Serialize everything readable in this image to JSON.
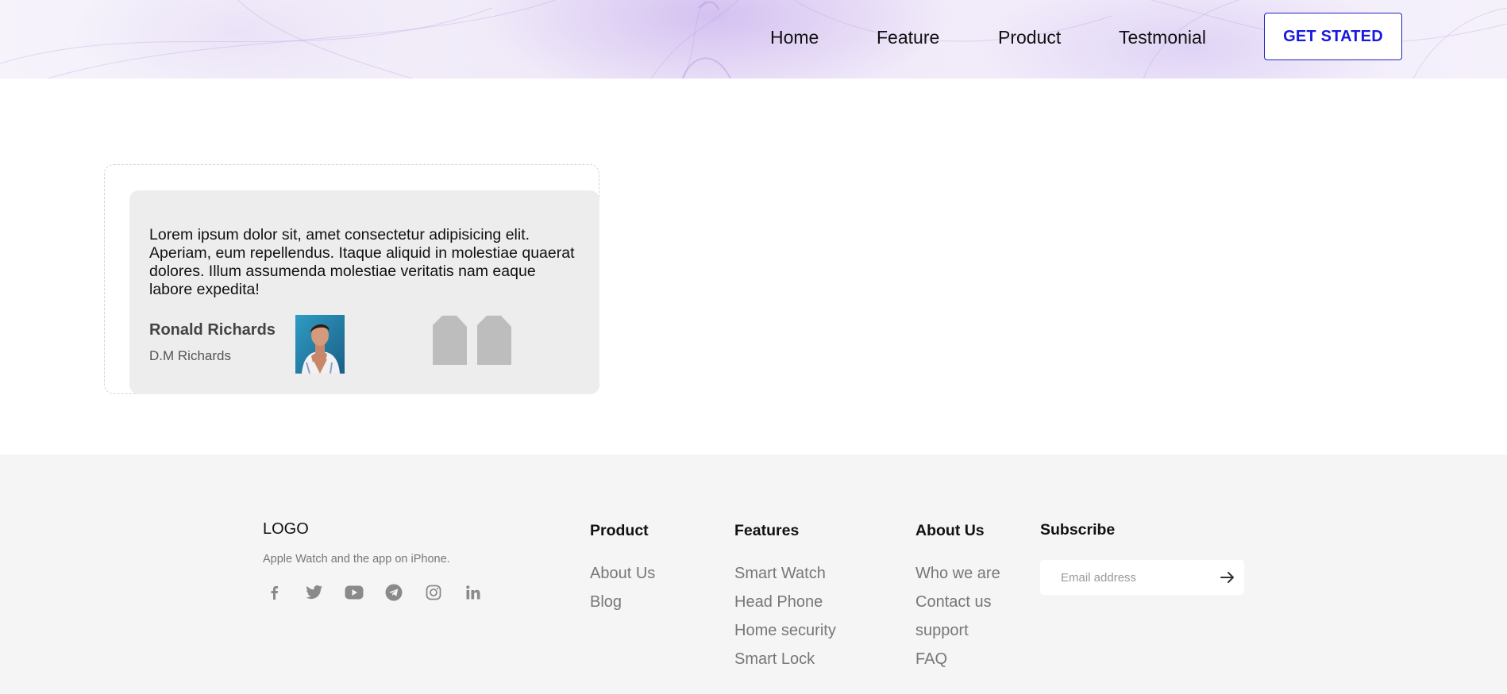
{
  "header": {
    "nav": {
      "home": "Home",
      "feature": "Feature",
      "product": "Product",
      "testimonial": "Testmonial"
    },
    "cta_label": "GET STATED"
  },
  "testimonial": {
    "quote": "Lorem ipsum dolor sit, amet consectetur adipisicing elit. Aperiam, eum repellendus. Itaque aliquid in molestiae quaerat dolores. Illum assumenda molestiae veritatis nam eaque labore expedita!",
    "author_name": "Ronald Richards",
    "author_role": "D.M Richards"
  },
  "footer": {
    "logo": "LOGO",
    "tagline": "Apple Watch and the app on iPhone.",
    "social_icons": [
      "facebook-icon",
      "twitter-icon",
      "youtube-icon",
      "telegram-icon",
      "instagram-icon",
      "linkedin-icon"
    ],
    "columns": {
      "product": {
        "heading": "Product",
        "links": [
          "About Us",
          "Blog"
        ]
      },
      "features": {
        "heading": "Features",
        "links": [
          "Smart Watch",
          "Head Phone",
          "Home security",
          "Smart Lock"
        ]
      },
      "about": {
        "heading": "About Us",
        "links": [
          "Who we are",
          "Contact us",
          "support",
          "FAQ"
        ]
      }
    },
    "subscribe": {
      "heading": "Subscribe",
      "placeholder": "Email address"
    }
  },
  "colors": {
    "accent": "#1818e0",
    "footer_bg": "#f5f5f5",
    "card_bg": "#ededed",
    "quote_mark": "#bdbdbd"
  }
}
